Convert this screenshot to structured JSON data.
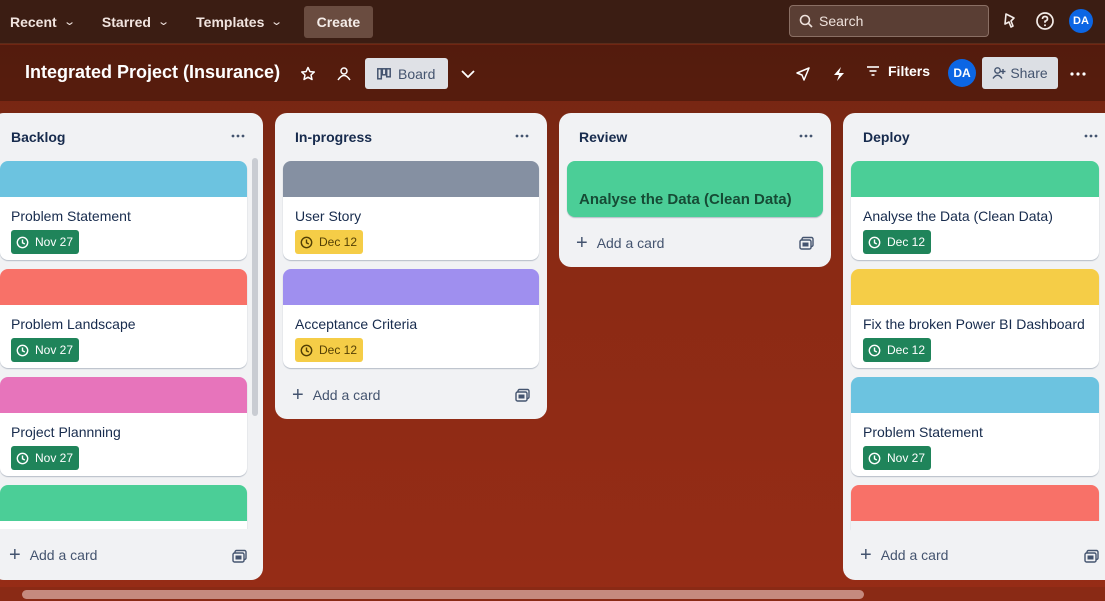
{
  "topnav": {
    "recent": "Recent",
    "starred": "Starred",
    "templates": "Templates",
    "create": "Create",
    "search_placeholder": "Search",
    "avatar": "DA"
  },
  "board": {
    "title": "Integrated Project (Insurance)",
    "view": "Board",
    "filters": "Filters",
    "share": "Share",
    "avatar": "DA"
  },
  "lists": [
    {
      "title": "Backlog",
      "cards": [
        {
          "title": "Problem Statement",
          "cover": "#6cc3e0",
          "date": "Nov 27",
          "status": "green"
        },
        {
          "title": "Problem Landscape",
          "cover": "#f87168",
          "date": "Nov 27",
          "status": "green"
        },
        {
          "title": "Project Plannning",
          "cover": "#e774bb",
          "date": "Nov 27",
          "status": "green"
        },
        {
          "title": "",
          "cover": "#4bce97"
        }
      ],
      "add_card": "Add a card"
    },
    {
      "title": "In-progress",
      "cards": [
        {
          "title": "User Story",
          "cover": "#8590a2",
          "date": "Dec 12",
          "status": "yellow"
        },
        {
          "title": "Acceptance Criteria",
          "cover": "#9f8fef",
          "date": "Dec 12",
          "status": "yellow"
        }
      ],
      "add_card": "Add a card"
    },
    {
      "title": "Review",
      "cards": [
        {
          "title": "Analyse the Data (Clean Data)",
          "cover": "#4bce97"
        }
      ],
      "add_card": "Add a card"
    },
    {
      "title": "Deploy",
      "cards": [
        {
          "title": "Analyse the Data (Clean Data)",
          "cover": "#4bce97",
          "date": "Dec 12",
          "status": "green"
        },
        {
          "title": "Fix the broken Power BI Dashboard",
          "cover": "#f5cd47",
          "date": "Dec 12",
          "status": "green"
        },
        {
          "title": "Problem Statement",
          "cover": "#6cc3e0",
          "date": "Nov 27",
          "status": "green"
        },
        {
          "title": "",
          "cover": "#f87168"
        }
      ],
      "add_card": "Add a card"
    }
  ],
  "colors": {
    "nav_bg": "#3b1d13",
    "board_bg": "#8a2a14",
    "list_bg": "#f1f2f4",
    "badge_green": "#1f845a",
    "badge_yellow": "#f5cd47"
  },
  "icons": [
    "chevron-down-icon",
    "search-icon",
    "notification-icon",
    "help-icon",
    "star-icon",
    "workspace-visibility-icon",
    "board-icon",
    "power-up-icon",
    "automation-icon",
    "filter-icon",
    "add-member-icon",
    "more-icon",
    "clock-icon",
    "plus-icon",
    "template-icon"
  ]
}
